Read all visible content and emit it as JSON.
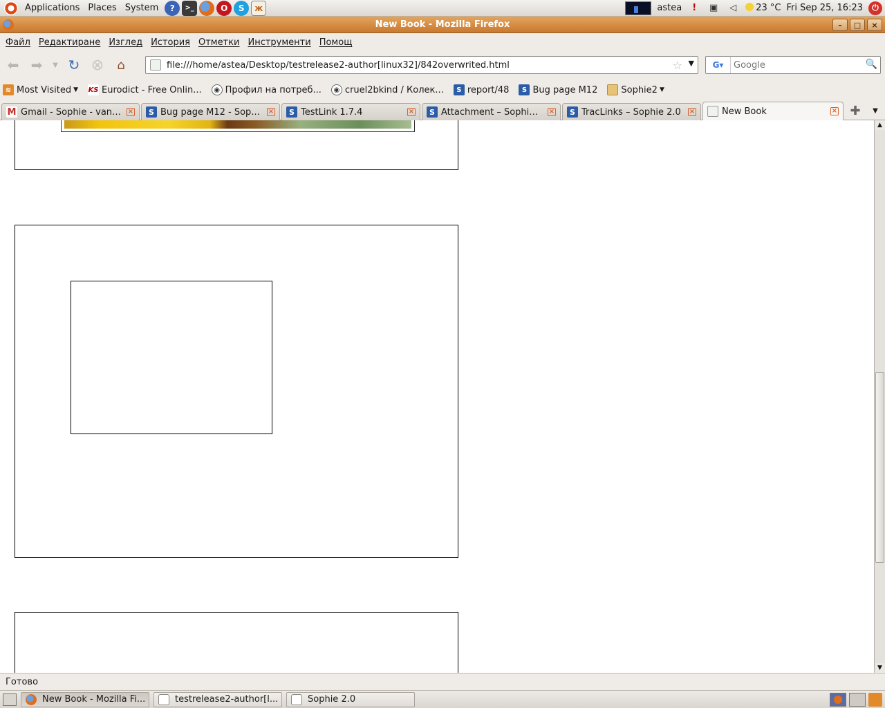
{
  "top_panel": {
    "menus": [
      "Applications",
      "Places",
      "System"
    ],
    "launchers": [
      "help-icon",
      "terminal-icon",
      "firefox-icon",
      "opera-icon",
      "skype-icon",
      "butterfly-icon"
    ],
    "user": "astea",
    "weather": "23 °C",
    "clock": "Fri Sep 25, 16:23"
  },
  "window": {
    "title": "New Book - Mozilla Firefox"
  },
  "menubar": [
    "Файл",
    "Редактиране",
    "Изглед",
    "История",
    "Отметки",
    "Инструменти",
    "Помощ"
  ],
  "navbar": {
    "url": "file:///home/astea/Desktop/testrelease2-author[linux32]/842overwrited.html",
    "search_placeholder": "Google"
  },
  "bookmarks": [
    {
      "label": "Most Visited",
      "icon": "rss-icon",
      "dropdown": true
    },
    {
      "label": "Eurodict - Free Onlin...",
      "icon": "ks-icon",
      "dropdown": false
    },
    {
      "label": "Профил на потреб...",
      "icon": "shield-icon",
      "dropdown": false
    },
    {
      "label": "cruel2bkind / Колек...",
      "icon": "shield-icon",
      "dropdown": false
    },
    {
      "label": "report/48",
      "icon": "sophie-icon",
      "dropdown": false
    },
    {
      "label": "Bug page M12",
      "icon": "sophie-icon",
      "dropdown": false
    },
    {
      "label": "Sophie2",
      "icon": "folder-icon",
      "dropdown": true
    }
  ],
  "tabs": [
    {
      "label": "Gmail - Sophie - vany...",
      "icon": "gmail-icon",
      "selected": false
    },
    {
      "label": "Bug page M12 - Sop...",
      "icon": "sophie-icon",
      "selected": false
    },
    {
      "label": "TestLink 1.7.4",
      "icon": "sophie-icon",
      "selected": false
    },
    {
      "label": "Attachment – Sophie ...",
      "icon": "sophie-icon",
      "selected": false
    },
    {
      "label": "TracLinks – Sophie 2.0",
      "icon": "sophie-icon",
      "selected": false
    },
    {
      "label": "New Book",
      "icon": "page-icon",
      "selected": true
    }
  ],
  "status": "Готово",
  "taskbar": [
    {
      "label": "New Book - Mozilla Fi...",
      "icon": "firefox-icon",
      "active": true
    },
    {
      "label": "testrelease2-author[l...",
      "icon": "document-icon",
      "active": false
    },
    {
      "label": "Sophie 2.0",
      "icon": "java-icon",
      "active": false
    }
  ],
  "colors": {
    "titlebar": "#d78a3f",
    "tab_close": "#d7622c",
    "sophie_icon": "#2b5ca8"
  }
}
